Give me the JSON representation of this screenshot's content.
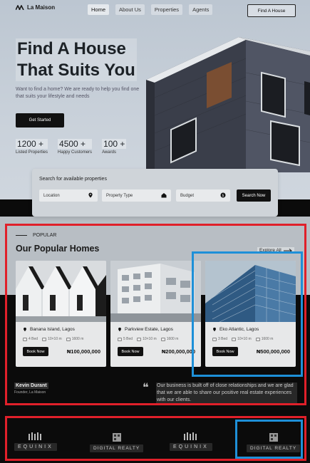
{
  "colors": {
    "accent": "#111111",
    "annotation_red": "#e0202a",
    "annotation_blue": "#1e90d8"
  },
  "nav": {
    "logo_text": "La Maison",
    "logo_icon": "house-roof-icon",
    "links": [
      "Home",
      "About Us",
      "Properties",
      "Agents"
    ],
    "active_link": "Home",
    "cta": "Find A House"
  },
  "hero": {
    "title_line1": "Find A House",
    "title_line2": "That Suits You",
    "subtitle": "Want to find a home? We are ready to help you find one that suits your lifestyle and needs",
    "cta": "Get Started",
    "stats": [
      {
        "value": "1200 +",
        "label": "Listed Properties"
      },
      {
        "value": "4500 +",
        "label": "Happy Customers"
      },
      {
        "value": "100 +",
        "label": "Awards"
      }
    ]
  },
  "search": {
    "title": "Search for available properties",
    "location": "Location",
    "location_icon": "map-pin-icon",
    "property_type": "Property Type",
    "property_type_icon": "home-icon",
    "budget": "Budget",
    "budget_icon": "money-icon",
    "button": "Search Now"
  },
  "popular": {
    "eyebrow": "POPULAR",
    "title": "Our Popular Homes",
    "explore": "Explore All",
    "explore_icon": "arrow-right-icon",
    "cards": [
      {
        "location": "Banana Island, Lagos",
        "beds": "4 Bed",
        "size": "10×10 m",
        "area": "1600 m",
        "button": "Book Now",
        "price": "₦100,000,000"
      },
      {
        "location": "Parkview Estate, Lagos",
        "beds": "5 Bed",
        "size": "10×10 m",
        "area": "1600 m",
        "button": "Book Now",
        "price": "₦200,000,000"
      },
      {
        "location": "Eko Atlantic, Lagos",
        "beds": "3 Bed",
        "size": "10×10 m",
        "area": "1600 m",
        "button": "Book Now",
        "price": "₦500,000,000"
      }
    ]
  },
  "testimonial": {
    "name": "Kevin Durant",
    "role": "Founder, La Maison",
    "text": "Our business is built off of close relationships and we are glad that we are able to share our positive real estate experiences with our clients."
  },
  "partners": [
    "EQUINIX",
    "DIGITAL REALTY",
    "EQUINIX",
    "DIGITAL REALTY"
  ]
}
